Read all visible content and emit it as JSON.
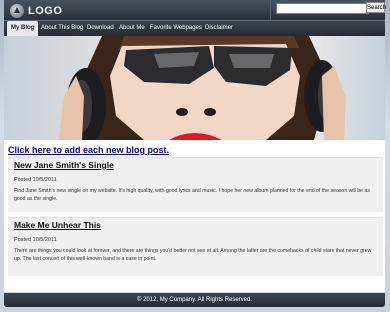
{
  "header": {
    "logo_text": "LOGO",
    "search": {
      "value": "",
      "button_label": "Search"
    }
  },
  "nav": {
    "items": [
      {
        "label": "My Blog",
        "active": true
      },
      {
        "label": "About This Blog"
      },
      {
        "label": "Download"
      },
      {
        "label": "About Me"
      },
      {
        "label": "Favorite Webpages"
      },
      {
        "label": "Disclaimer"
      }
    ]
  },
  "main": {
    "add_post_link": "Click here to add each new blog post.",
    "posts": [
      {
        "title": "New Jane Smith's Single",
        "date": "Posted 10/5/2011",
        "body": "Find Jane Smith's new single on my website. It's high quality, with good lyrics and music. I hope her new album planned for the end of the season will be as good as the single."
      },
      {
        "title": "Make Me Unhear This",
        "date": "Posted 10/5/2011",
        "body": "There are things you could look at forever, and there are things you'd better not see at all. Among the latter are the comebacks of child stars that never grew up. The last concert of this well-known band is a case in point."
      }
    ]
  },
  "footer": {
    "text": "© 2012. My Company. All Rights Reserved."
  }
}
